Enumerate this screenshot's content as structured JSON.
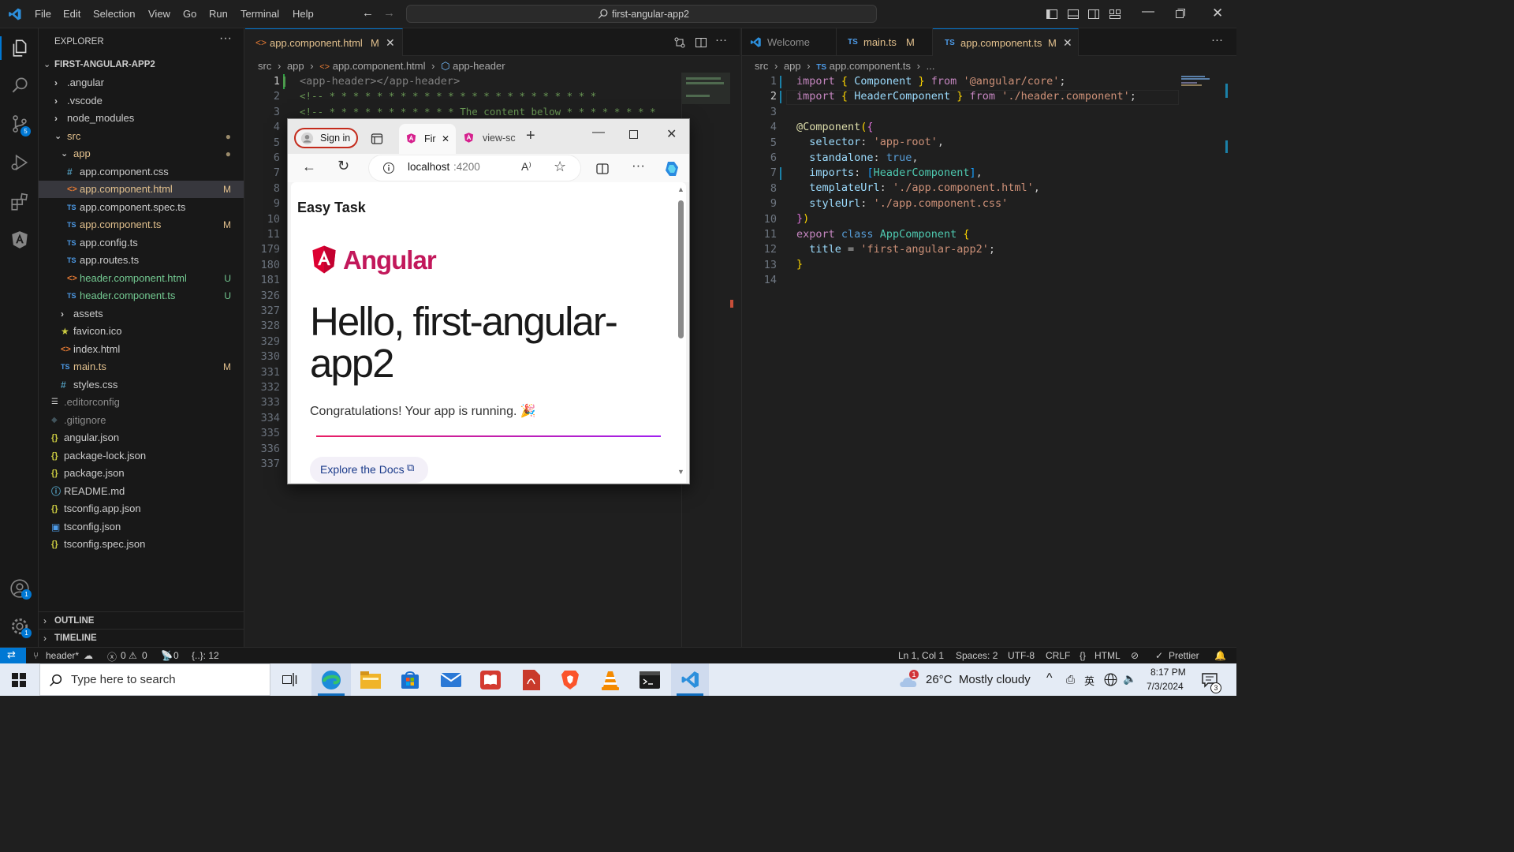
{
  "titlebar": {
    "menu": [
      "File",
      "Edit",
      "Selection",
      "View",
      "Go",
      "Run",
      "Terminal",
      "Help"
    ],
    "search": "first-angular-app2"
  },
  "activity_badges": {
    "source_control": "5",
    "accounts": "1",
    "settings": "1"
  },
  "explorer": {
    "title": "EXPLORER",
    "root": "FIRST-ANGULAR-APP2",
    "items": [
      {
        "label": ".angular",
        "kind": "folder",
        "badge": ""
      },
      {
        "label": ".vscode",
        "kind": "folder",
        "badge": ""
      },
      {
        "label": "node_modules",
        "kind": "folder",
        "badge": ""
      },
      {
        "label": "src",
        "kind": "folder-open",
        "badge": "●"
      },
      {
        "label": "app",
        "kind": "folder-open",
        "badge": "●"
      },
      {
        "label": "app.component.css",
        "kind": "css",
        "badge": ""
      },
      {
        "label": "app.component.html",
        "kind": "html",
        "badge": "M"
      },
      {
        "label": "app.component.spec.ts",
        "kind": "ts",
        "badge": ""
      },
      {
        "label": "app.component.ts",
        "kind": "ts",
        "badge": "M"
      },
      {
        "label": "app.config.ts",
        "kind": "ts",
        "badge": ""
      },
      {
        "label": "app.routes.ts",
        "kind": "ts",
        "badge": ""
      },
      {
        "label": "header.component.html",
        "kind": "html",
        "badge": "U"
      },
      {
        "label": "header.component.ts",
        "kind": "ts",
        "badge": "U"
      },
      {
        "label": "assets",
        "kind": "folder",
        "badge": ""
      },
      {
        "label": "favicon.ico",
        "kind": "ico",
        "badge": ""
      },
      {
        "label": "index.html",
        "kind": "html",
        "badge": ""
      },
      {
        "label": "main.ts",
        "kind": "ts",
        "badge": "M"
      },
      {
        "label": "styles.css",
        "kind": "css",
        "badge": ""
      },
      {
        "label": ".editorconfig",
        "kind": "cfg",
        "badge": ""
      },
      {
        "label": ".gitignore",
        "kind": "git",
        "badge": ""
      },
      {
        "label": "angular.json",
        "kind": "json",
        "badge": ""
      },
      {
        "label": "package-lock.json",
        "kind": "json",
        "badge": ""
      },
      {
        "label": "package.json",
        "kind": "json",
        "badge": ""
      },
      {
        "label": "README.md",
        "kind": "info",
        "badge": ""
      },
      {
        "label": "tsconfig.app.json",
        "kind": "json",
        "badge": ""
      },
      {
        "label": "tsconfig.json",
        "kind": "tsjson",
        "badge": ""
      },
      {
        "label": "tsconfig.spec.json",
        "kind": "json",
        "badge": ""
      }
    ],
    "outline": "OUTLINE",
    "timeline": "TIMELINE"
  },
  "editor_left": {
    "tab": {
      "label": "app.component.html",
      "badge": "M"
    },
    "breadcrumb": [
      "src",
      "app",
      "app.component.html",
      "app-header"
    ],
    "line_numbers": [
      "1",
      "2",
      "3",
      "4",
      "5",
      "6",
      "7",
      "8",
      "9",
      "10",
      "11",
      "179",
      "180",
      "181",
      "326",
      "327",
      "328",
      "329",
      "330",
      "331",
      "332",
      "333",
      "334",
      "335",
      "336",
      "337"
    ],
    "line1": "<app-header></app-header>",
    "line2": "<!-- * * * * * * * * * * * * * * * * * * * * * * *",
    "line3": "<!-- * * * * * * * * * * * The content below * * * * * * * *"
  },
  "editor_right": {
    "tabs": [
      {
        "label": "Welcome",
        "badge": ""
      },
      {
        "label": "main.ts",
        "badge": "M"
      },
      {
        "label": "app.component.ts",
        "badge": "M"
      }
    ],
    "breadcrumb": [
      "src",
      "app",
      "app.component.ts",
      "..."
    ],
    "line_numbers": [
      "1",
      "2",
      "3",
      "4",
      "5",
      "6",
      "7",
      "8",
      "9",
      "10",
      "11",
      "12",
      "13",
      "14"
    ]
  },
  "browser": {
    "signin": "Sign in",
    "tab1": "Fir",
    "tab2": "view-sc",
    "address_host": "localhost",
    "address_port": ":4200",
    "page": {
      "header": "Easy Task",
      "logo_text": "Angular",
      "heading": "Hello, first-angular-app2",
      "message": "Congratulations! Your app is running. 🎉",
      "docs_link": "Explore the Docs"
    }
  },
  "statusbar": {
    "branch": "header*",
    "errors": "0",
    "warnings": "0",
    "ports": "0",
    "selection": "{..}: 12",
    "position": "Ln 1, Col 1",
    "spaces": "Spaces: 2",
    "encoding": "UTF-8",
    "eol": "CRLF",
    "language": "HTML",
    "formatter": "Prettier"
  },
  "taskbar": {
    "search_placeholder": "Type here to search",
    "weather": "26°C  Mostly cloudy",
    "weather_badge": "1",
    "time": "8:17 PM",
    "date": "7/3/2024",
    "notif": "3"
  },
  "colors": {
    "accent": "#0078d4",
    "modified": "#e2c08d",
    "untracked": "#73c991",
    "angular": "#dd0031"
  }
}
